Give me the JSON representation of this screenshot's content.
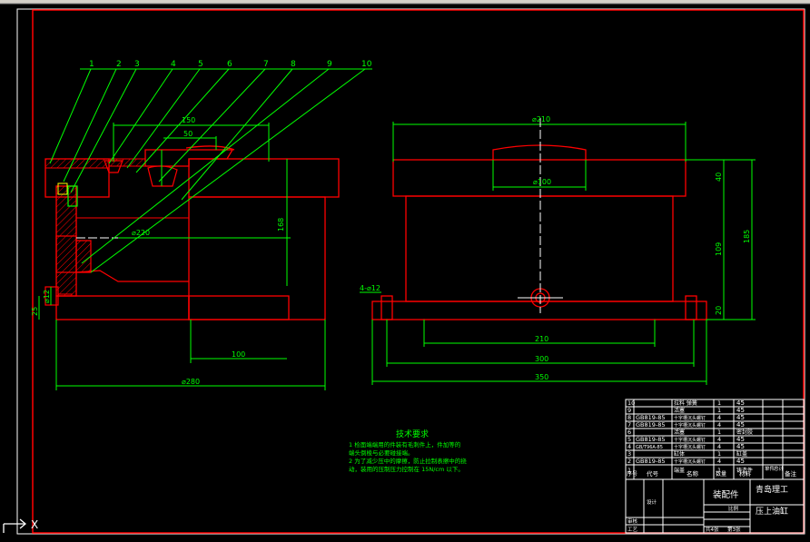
{
  "drawing": {
    "balloons": [
      "1",
      "2",
      "3",
      "4",
      "5",
      "6",
      "7",
      "8",
      "9",
      "10"
    ],
    "left_view_dims": {
      "top_width": "150",
      "top_inner": "50",
      "bore": "⌀220",
      "height": "168",
      "bottom_width": "100",
      "overall": "⌀280",
      "left_small": "25",
      "left_hole": "⌀12"
    },
    "right_view_dims": {
      "top_dia": "⌀210",
      "boss_dia": "⌀100",
      "right_40": "40",
      "right_109": "109",
      "right_20": "20",
      "right_185": "185",
      "holes": "4-⌀12",
      "w210": "210",
      "w300": "300",
      "w350": "350"
    },
    "notes": {
      "title": "技术要求",
      "line1": "1 检面端端用的件装有毛刺件上，件加等的",
      "line1b": "   端头倒棱与必要碰接端。",
      "line2": "2 为了减少压中的摩擦，防止拉制表擦中的挠",
      "line2b": "   动，装用的压制压力控制在 15N/cm 以下。"
    },
    "title_block": {
      "rows": [
        {
          "no": "10",
          "code": "",
          "name": "拉料 弹簧",
          "qty": "1",
          "mat": "45"
        },
        {
          "no": "9",
          "code": "",
          "name": "活塞",
          "qty": "1",
          "mat": "45"
        },
        {
          "no": "8",
          "code": "GB819-85",
          "name": "十字槽沉头螺钉",
          "qty": "4",
          "mat": "45"
        },
        {
          "no": "7",
          "code": "GB819-85",
          "name": "十字槽沉头螺钉",
          "qty": "4",
          "mat": "45"
        },
        {
          "no": "6",
          "code": "",
          "name": "活塞",
          "qty": "1",
          "mat": "密封胶"
        },
        {
          "no": "5",
          "code": "GB819-85",
          "name": "十字槽沉头螺钉",
          "qty": "4",
          "mat": "45"
        },
        {
          "no": "4",
          "code": "GB/T96A-85",
          "name": "十字槽沉头螺钉",
          "qty": "4",
          "mat": "45"
        },
        {
          "no": "3",
          "code": "",
          "name": "缸体",
          "qty": "1",
          "mat": "缸盖"
        },
        {
          "no": "2",
          "code": "GB819-85",
          "name": "十字槽沉头螺钉",
          "qty": "4",
          "mat": "45"
        },
        {
          "no": "1",
          "code": "",
          "name": "端盖",
          "qty": "1",
          "mat": "铸造件"
        }
      ],
      "header": {
        "no": "序号",
        "code": "代号",
        "name": "名称",
        "qty": "数量",
        "mat": "材料",
        "note1": "单件",
        "note2": "总计",
        "remark": "备注"
      },
      "assembly": "装配件",
      "company": "青岛理工",
      "part_name": "压上油缸",
      "signers": [
        "设计",
        "审核",
        "工艺"
      ],
      "sheet_labels": {
        "total": "共4张",
        "sheet": "第3张",
        "scale": "比例"
      }
    },
    "ucs": {
      "x_label": "X"
    }
  },
  "colors": {
    "background": "#000000",
    "green": "#00ff00",
    "red": "#ff0000",
    "white": "#ffffff",
    "yellow": "#ffff00"
  }
}
